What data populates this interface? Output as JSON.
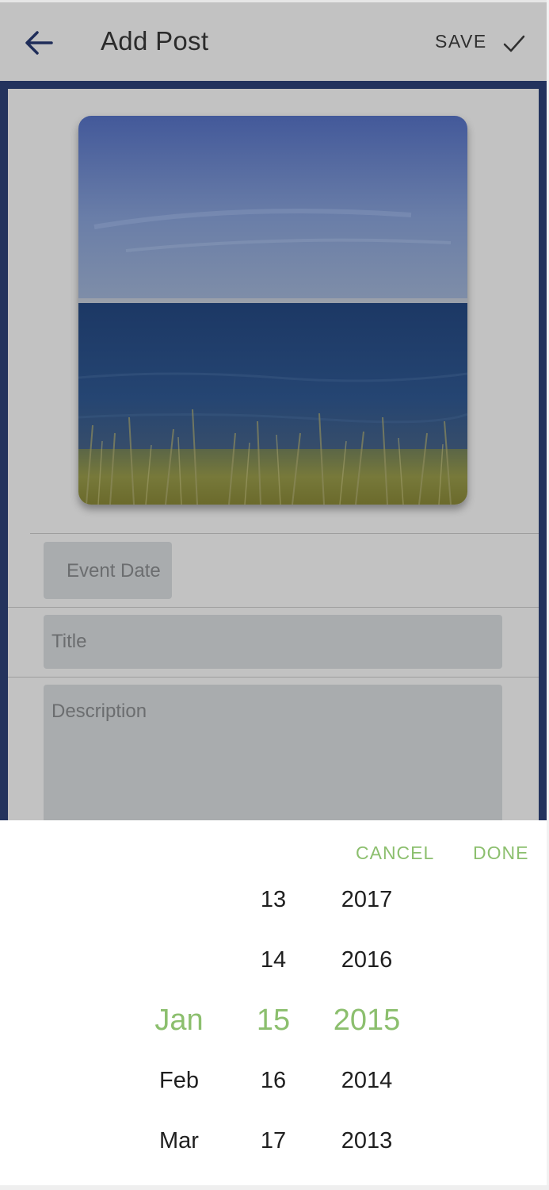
{
  "app_bar": {
    "title": "Add Post",
    "save_label": "SAVE",
    "back_icon": "arrow-left-icon",
    "check_icon": "check-icon"
  },
  "form": {
    "event_date_placeholder": "Event Date",
    "title_placeholder": "Title",
    "description_placeholder": "Description"
  },
  "picker": {
    "cancel_label": "CANCEL",
    "done_label": "DONE",
    "months": [
      "",
      "",
      "Jan",
      "Feb",
      "Mar"
    ],
    "days": [
      "13",
      "14",
      "15",
      "16",
      "17"
    ],
    "years": [
      "2017",
      "2016",
      "2015",
      "2014",
      "2013"
    ],
    "selected": {
      "month": "Jan",
      "day": "15",
      "year": "2015"
    }
  },
  "colors": {
    "accent": "#8cbf6e",
    "overlay_gray": "#c2c2c2",
    "frame_navy": "#23335d",
    "icon_navy": "#1f2d59"
  }
}
